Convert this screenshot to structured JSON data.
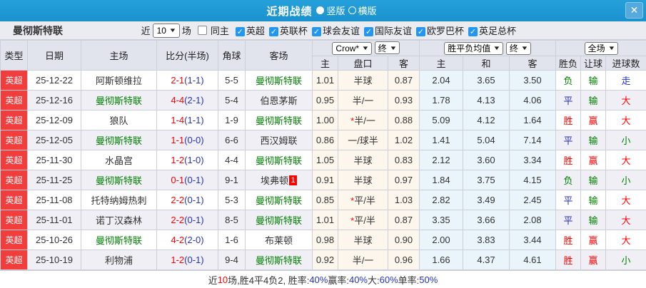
{
  "titlebar": {
    "title": "近期战绩",
    "view_options": [
      {
        "label": "竖版",
        "selected": true
      },
      {
        "label": "横版",
        "selected": false
      }
    ],
    "close_icon": "✕"
  },
  "filterbar": {
    "team": "曼彻斯特联",
    "recent_prefix": "近",
    "recent_value": "10",
    "recent_suffix": "场",
    "same_home": {
      "label": "同主",
      "checked": false
    },
    "leagues": [
      {
        "label": "英超",
        "checked": true
      },
      {
        "label": "英联杯",
        "checked": true
      },
      {
        "label": "球会友谊",
        "checked": true
      },
      {
        "label": "国际友谊",
        "checked": true
      },
      {
        "label": "欧罗巴杯",
        "checked": true
      },
      {
        "label": "英足总杯",
        "checked": true
      }
    ]
  },
  "table": {
    "header": {
      "type": "类型",
      "date": "日期",
      "home": "主场",
      "score": "比分(半场)",
      "corner": "角球",
      "away": "客场",
      "odds_source_select": "Crow*",
      "odds_final_select": "终",
      "avg_select": "胜平负均值",
      "avg_final_select": "终",
      "scope_select": "全场",
      "sub": [
        "主",
        "盘口",
        "客",
        "主",
        "和",
        "客",
        "胜负",
        "让球",
        "进球数"
      ]
    },
    "rows": [
      {
        "type": "英超",
        "date": "25-12-22",
        "home": "阿斯顿维拉",
        "home_is_subject": false,
        "score": "2-1",
        "half": "(1-1)",
        "corner": "5-5",
        "away": "曼彻斯特联",
        "away_is_subject": true,
        "away_red_cards": "",
        "odds_home": "1.01",
        "handicap_star": false,
        "handicap": "半球",
        "odds_away": "0.87",
        "avg_win": "2.04",
        "avg_draw": "3.65",
        "avg_lose": "3.50",
        "result_wdl": {
          "text": "负",
          "color": "green"
        },
        "result_handicap": {
          "text": "输",
          "color": "green"
        },
        "result_goals": {
          "text": "走",
          "color": "blue"
        }
      },
      {
        "type": "英超",
        "date": "25-12-16",
        "home": "曼彻斯特联",
        "home_is_subject": true,
        "score": "4-4",
        "half": "(2-1)",
        "corner": "5-4",
        "away": "伯恩茅斯",
        "away_is_subject": false,
        "away_red_cards": "",
        "odds_home": "0.95",
        "handicap_star": false,
        "handicap": "半/一",
        "odds_away": "0.93",
        "avg_win": "1.78",
        "avg_draw": "4.13",
        "avg_lose": "4.06",
        "result_wdl": {
          "text": "平",
          "color": "blue"
        },
        "result_handicap": {
          "text": "输",
          "color": "green"
        },
        "result_goals": {
          "text": "大",
          "color": "red"
        }
      },
      {
        "type": "英超",
        "date": "25-12-09",
        "home": "狼队",
        "home_is_subject": false,
        "score": "1-4",
        "half": "(1-1)",
        "corner": "1-9",
        "away": "曼彻斯特联",
        "away_is_subject": true,
        "away_red_cards": "",
        "odds_home": "1.00",
        "handicap_star": true,
        "handicap": "半/一",
        "odds_away": "0.88",
        "avg_win": "5.09",
        "avg_draw": "4.12",
        "avg_lose": "1.64",
        "result_wdl": {
          "text": "胜",
          "color": "red"
        },
        "result_handicap": {
          "text": "赢",
          "color": "red"
        },
        "result_goals": {
          "text": "大",
          "color": "red"
        }
      },
      {
        "type": "英超",
        "date": "25-12-05",
        "home": "曼彻斯特联",
        "home_is_subject": true,
        "score": "1-1",
        "half": "(0-0)",
        "corner": "6-6",
        "away": "西汉姆联",
        "away_is_subject": false,
        "away_red_cards": "",
        "odds_home": "0.86",
        "handicap_star": false,
        "handicap": "一/球半",
        "odds_away": "1.02",
        "avg_win": "1.41",
        "avg_draw": "5.04",
        "avg_lose": "7.14",
        "result_wdl": {
          "text": "平",
          "color": "blue"
        },
        "result_handicap": {
          "text": "输",
          "color": "green"
        },
        "result_goals": {
          "text": "小",
          "color": "green"
        }
      },
      {
        "type": "英超",
        "date": "25-11-30",
        "home": "水晶宫",
        "home_is_subject": false,
        "score": "1-2",
        "half": "(1-0)",
        "corner": "4-4",
        "away": "曼彻斯特联",
        "away_is_subject": true,
        "away_red_cards": "",
        "odds_home": "1.05",
        "handicap_star": false,
        "handicap": "半球",
        "odds_away": "0.83",
        "avg_win": "2.12",
        "avg_draw": "3.60",
        "avg_lose": "3.34",
        "result_wdl": {
          "text": "胜",
          "color": "red"
        },
        "result_handicap": {
          "text": "赢",
          "color": "red"
        },
        "result_goals": {
          "text": "大",
          "color": "red"
        }
      },
      {
        "type": "英超",
        "date": "25-11-25",
        "home": "曼彻斯特联",
        "home_is_subject": true,
        "score": "0-1",
        "half": "(0-1)",
        "corner": "9-1",
        "away": "埃弗顿",
        "away_is_subject": false,
        "away_red_cards": "1",
        "odds_home": "0.91",
        "handicap_star": false,
        "handicap": "半球",
        "odds_away": "0.97",
        "avg_win": "1.84",
        "avg_draw": "3.75",
        "avg_lose": "4.15",
        "result_wdl": {
          "text": "负",
          "color": "green"
        },
        "result_handicap": {
          "text": "输",
          "color": "green"
        },
        "result_goals": {
          "text": "小",
          "color": "green"
        }
      },
      {
        "type": "英超",
        "date": "25-11-08",
        "home": "托特纳姆热刺",
        "home_is_subject": false,
        "score": "2-2",
        "half": "(0-1)",
        "corner": "5-3",
        "away": "曼彻斯特联",
        "away_is_subject": true,
        "away_red_cards": "",
        "odds_home": "0.85",
        "handicap_star": true,
        "handicap": "平/半",
        "odds_away": "1.03",
        "avg_win": "2.82",
        "avg_draw": "3.49",
        "avg_lose": "2.45",
        "result_wdl": {
          "text": "平",
          "color": "blue"
        },
        "result_handicap": {
          "text": "输",
          "color": "green"
        },
        "result_goals": {
          "text": "大",
          "color": "red"
        }
      },
      {
        "type": "英超",
        "date": "25-11-01",
        "home": "诺丁汉森林",
        "home_is_subject": false,
        "score": "2-2",
        "half": "(0-1)",
        "corner": "8-5",
        "away": "曼彻斯特联",
        "away_is_subject": true,
        "away_red_cards": "",
        "odds_home": "1.01",
        "handicap_star": true,
        "handicap": "平/半",
        "odds_away": "0.87",
        "avg_win": "3.35",
        "avg_draw": "3.66",
        "avg_lose": "2.08",
        "result_wdl": {
          "text": "平",
          "color": "blue"
        },
        "result_handicap": {
          "text": "输",
          "color": "green"
        },
        "result_goals": {
          "text": "大",
          "color": "red"
        }
      },
      {
        "type": "英超",
        "date": "25-10-26",
        "home": "曼彻斯特联",
        "home_is_subject": true,
        "score": "4-2",
        "half": "(2-0)",
        "corner": "1-6",
        "away": "布莱顿",
        "away_is_subject": false,
        "away_red_cards": "",
        "odds_home": "0.98",
        "handicap_star": false,
        "handicap": "半球",
        "odds_away": "0.90",
        "avg_win": "2.00",
        "avg_draw": "3.83",
        "avg_lose": "3.44",
        "result_wdl": {
          "text": "胜",
          "color": "red"
        },
        "result_handicap": {
          "text": "赢",
          "color": "red"
        },
        "result_goals": {
          "text": "大",
          "color": "red"
        }
      },
      {
        "type": "英超",
        "date": "25-10-19",
        "home": "利物浦",
        "home_is_subject": false,
        "score": "1-2",
        "half": "(0-1)",
        "corner": "9-4",
        "away": "曼彻斯特联",
        "away_is_subject": true,
        "away_red_cards": "",
        "odds_home": "0.92",
        "handicap_star": false,
        "handicap": "半/一",
        "odds_away": "0.96",
        "avg_win": "1.66",
        "avg_draw": "4.37",
        "avg_lose": "4.61",
        "result_wdl": {
          "text": "胜",
          "color": "red"
        },
        "result_handicap": {
          "text": "赢",
          "color": "red"
        },
        "result_goals": {
          "text": "小",
          "color": "green"
        }
      }
    ]
  },
  "summary": {
    "segments": [
      {
        "text": "近",
        "color": "dark"
      },
      {
        "text": "10",
        "color": "red"
      },
      {
        "text": "场,胜4平4负2, 胜率:",
        "color": "dark"
      },
      {
        "text": "40%",
        "color": "blue"
      },
      {
        "text": " 赢率:",
        "color": "dark"
      },
      {
        "text": "40%",
        "color": "blue"
      },
      {
        "text": " 大:",
        "color": "dark"
      },
      {
        "text": "60%",
        "color": "blue"
      },
      {
        "text": " 单率:",
        "color": "dark"
      },
      {
        "text": "50%",
        "color": "blue"
      }
    ]
  }
}
